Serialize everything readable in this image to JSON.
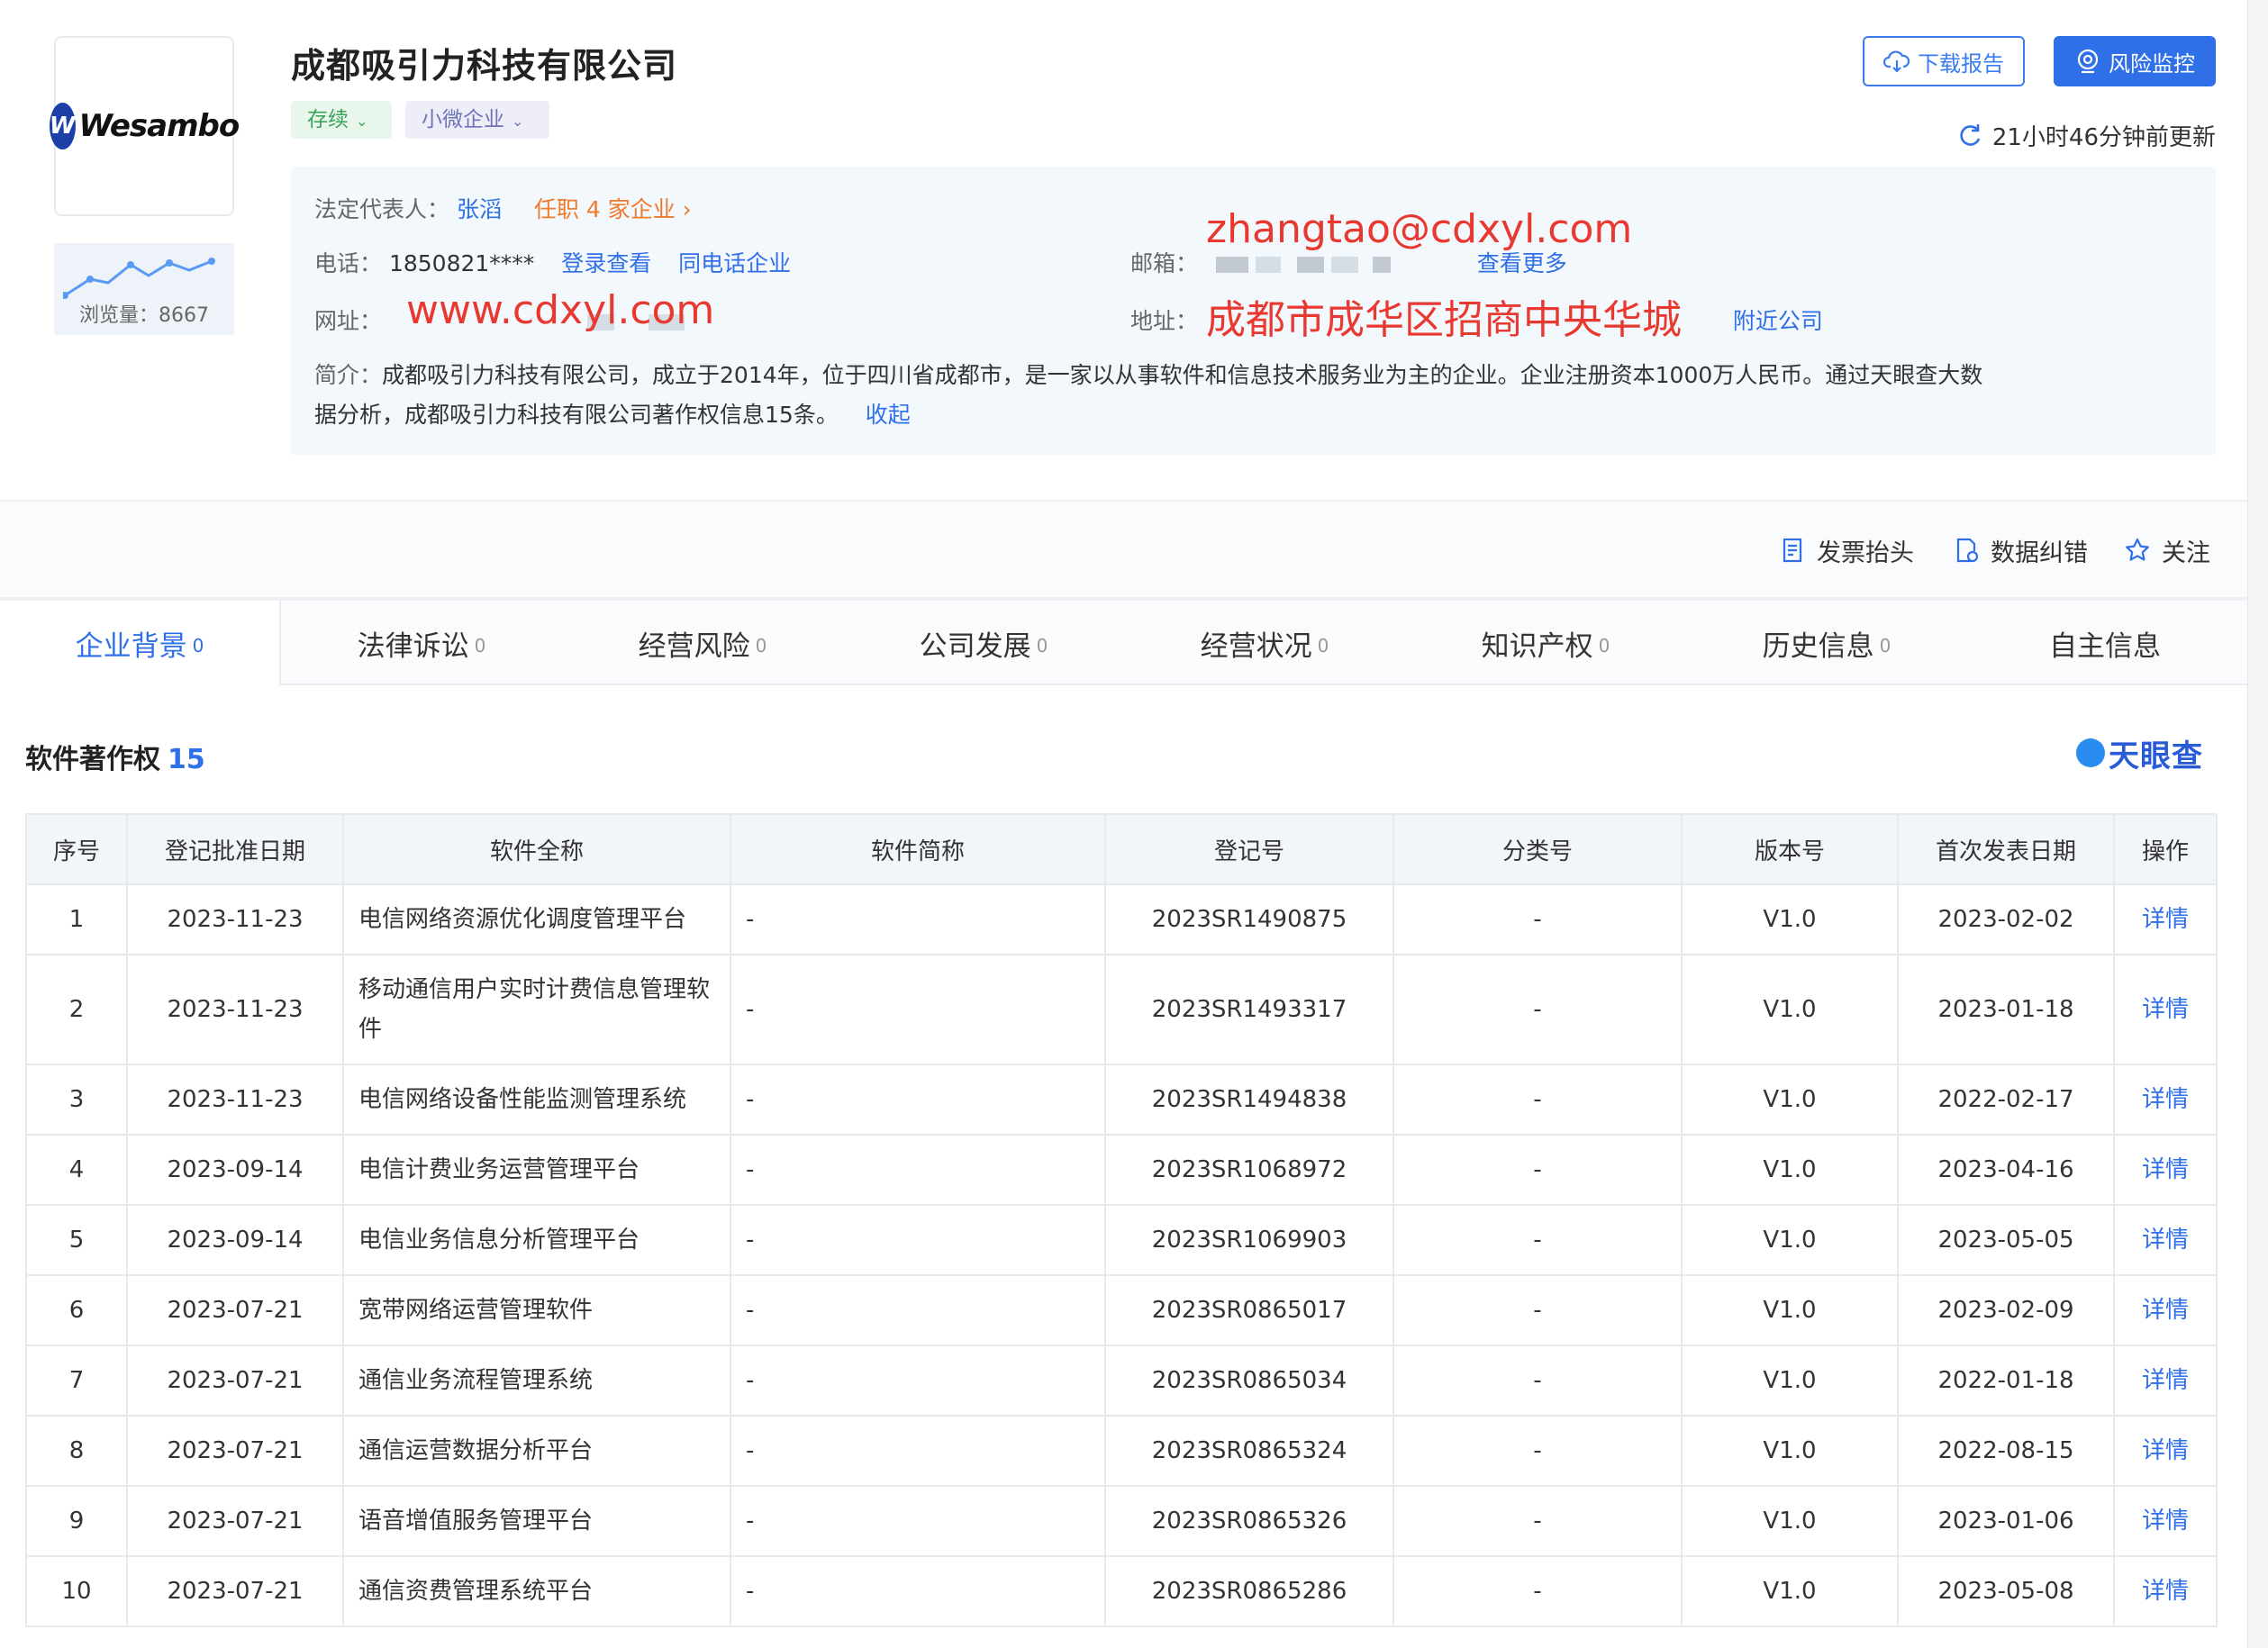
{
  "company": {
    "name": "成都吸引力科技有限公司",
    "logo_text": "Wesambo",
    "logo_mark": "W",
    "status_tag": "存续",
    "size_tag": "小微企业",
    "views_label": "浏览量：8667"
  },
  "header_actions": {
    "download_label": "下载报告",
    "monitor_label": "风险监控",
    "update_text": "21小时46分钟前更新"
  },
  "info": {
    "legal_rep_label": "法定代表人：",
    "legal_rep_name": "张滔",
    "legal_rep_positions": "任职 4 家企业",
    "phone_label": "电话：",
    "phone_value": "1850821****",
    "phone_login": "登录查看",
    "phone_same": "同电话企业",
    "email_label": "邮箱：",
    "email_overlay": "zhangtao@cdxyl.com",
    "email_more": "查看更多",
    "website_label": "网址：",
    "website_overlay": "www.cdxyl.com",
    "address_label": "地址：",
    "address_overlay": "成都市成华区招商中央华城",
    "address_nearby": "附近公司",
    "intro_label": "简介：",
    "intro_line1": "成都吸引力科技有限公司，成立于2014年，位于四川省成都市，是一家以从事软件和信息技术服务业为主的企业。企业注册资本1000万人民币。通过天眼查大数",
    "intro_line2": "据分析，成都吸引力科技有限公司著作权信息15条。",
    "intro_collapse": "收起"
  },
  "toolbar": {
    "invoice_label": "发票抬头",
    "correction_label": "数据纠错",
    "follow_label": "关注"
  },
  "tabs": [
    {
      "label": "企业背景",
      "count": "0"
    },
    {
      "label": "法律诉讼",
      "count": "0"
    },
    {
      "label": "经营风险",
      "count": "0"
    },
    {
      "label": "公司发展",
      "count": "0"
    },
    {
      "label": "经营状况",
      "count": "0"
    },
    {
      "label": "知识产权",
      "count": "0"
    },
    {
      "label": "历史信息",
      "count": "0"
    },
    {
      "label": "自主信息",
      "count": ""
    }
  ],
  "section": {
    "title": "软件著作权",
    "count": "15",
    "brand": "天眼查"
  },
  "table": {
    "headers": [
      "序号",
      "登记批准日期",
      "软件全称",
      "软件简称",
      "登记号",
      "分类号",
      "版本号",
      "首次发表日期",
      "操作"
    ],
    "rows": [
      {
        "no": "1",
        "date": "2023-11-23",
        "name": "电信网络资源优化调度管理平台",
        "short": "-",
        "reg": "2023SR1490875",
        "cls": "-",
        "ver": "V1.0",
        "pub": "2023-02-02",
        "op": "详情"
      },
      {
        "no": "2",
        "date": "2023-11-23",
        "name": "移动通信用户实时计费信息管理软件",
        "short": "-",
        "reg": "2023SR1493317",
        "cls": "-",
        "ver": "V1.0",
        "pub": "2023-01-18",
        "op": "详情"
      },
      {
        "no": "3",
        "date": "2023-11-23",
        "name": "电信网络设备性能监测管理系统",
        "short": "-",
        "reg": "2023SR1494838",
        "cls": "-",
        "ver": "V1.0",
        "pub": "2022-02-17",
        "op": "详情"
      },
      {
        "no": "4",
        "date": "2023-09-14",
        "name": "电信计费业务运营管理平台",
        "short": "-",
        "reg": "2023SR1068972",
        "cls": "-",
        "ver": "V1.0",
        "pub": "2023-04-16",
        "op": "详情"
      },
      {
        "no": "5",
        "date": "2023-09-14",
        "name": "电信业务信息分析管理平台",
        "short": "-",
        "reg": "2023SR1069903",
        "cls": "-",
        "ver": "V1.0",
        "pub": "2023-05-05",
        "op": "详情"
      },
      {
        "no": "6",
        "date": "2023-07-21",
        "name": "宽带网络运营管理软件",
        "short": "-",
        "reg": "2023SR0865017",
        "cls": "-",
        "ver": "V1.0",
        "pub": "2023-02-09",
        "op": "详情"
      },
      {
        "no": "7",
        "date": "2023-07-21",
        "name": "通信业务流程管理系统",
        "short": "-",
        "reg": "2023SR0865034",
        "cls": "-",
        "ver": "V1.0",
        "pub": "2022-01-18",
        "op": "详情"
      },
      {
        "no": "8",
        "date": "2023-07-21",
        "name": "通信运营数据分析平台",
        "short": "-",
        "reg": "2023SR0865324",
        "cls": "-",
        "ver": "V1.0",
        "pub": "2022-08-15",
        "op": "详情"
      },
      {
        "no": "9",
        "date": "2023-07-21",
        "name": "语音增值服务管理平台",
        "short": "-",
        "reg": "2023SR0865326",
        "cls": "-",
        "ver": "V1.0",
        "pub": "2023-01-06",
        "op": "详情"
      },
      {
        "no": "10",
        "date": "2023-07-21",
        "name": "通信资费管理系统平台",
        "short": "-",
        "reg": "2023SR0865286",
        "cls": "-",
        "ver": "V1.0",
        "pub": "2023-05-08",
        "op": "详情"
      }
    ]
  },
  "colors": {
    "accent": "#2f6fe8",
    "overlay_red": "#e8382f",
    "orange": "#f07a2b",
    "status_green": "#3aa45b"
  }
}
